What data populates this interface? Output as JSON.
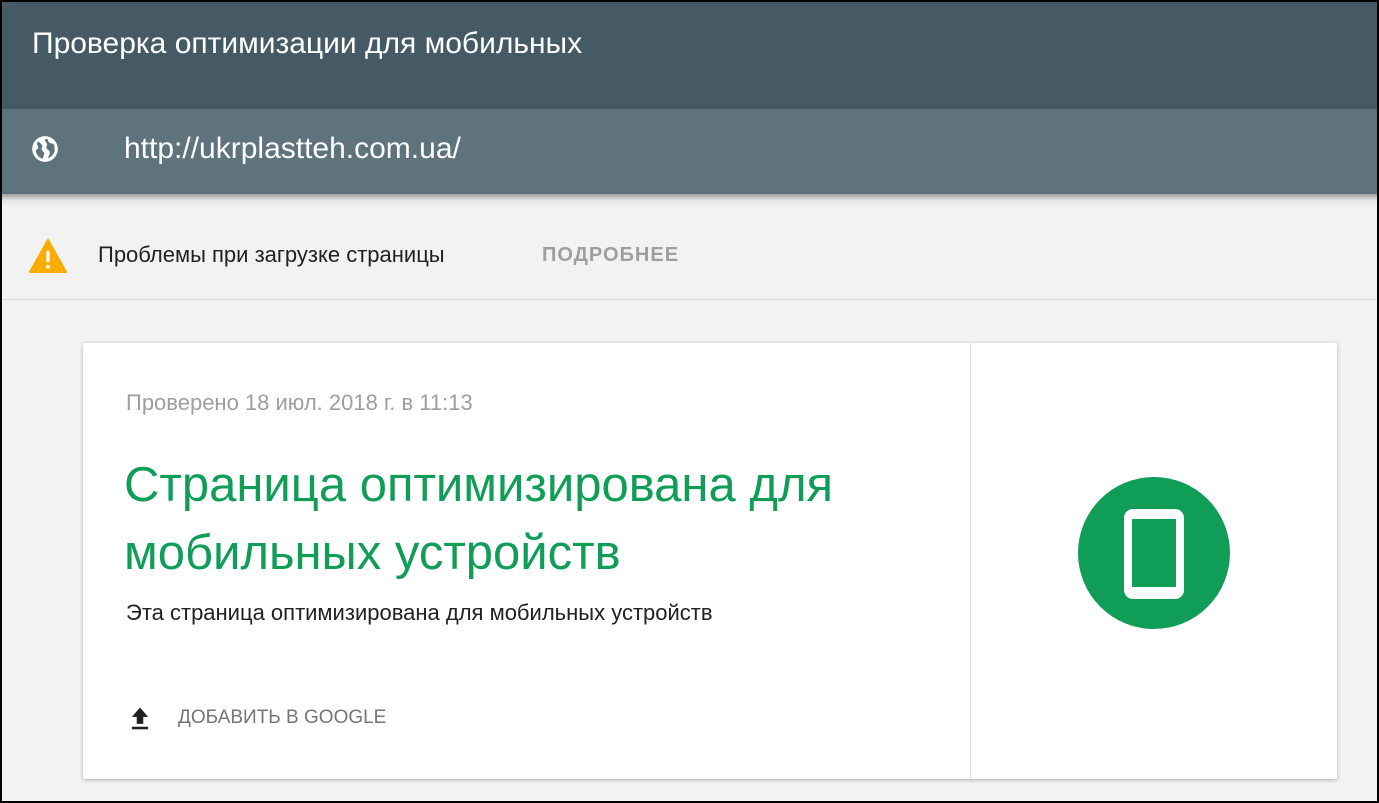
{
  "app": {
    "title": "Проверка оптимизации для мобильных"
  },
  "url_bar": {
    "icon": "globe-icon",
    "value": "http://ukrplastteh.com.ua/"
  },
  "warning": {
    "icon": "warning-icon",
    "text": "Проблемы при загрузке страницы",
    "details_label": "ПОДРОБНЕЕ",
    "color": "#f9ab00"
  },
  "result": {
    "checked_at": "Проверено 18 июл. 2018 г. в 11:13",
    "heading": "Страница оптимизирована для мобильных устройств",
    "description": "Эта страница оптимизирована для мобильных устройств",
    "submit_label": "ДОБАВИТЬ В GOOGLE",
    "submit_icon": "upload-icon",
    "status_icon": "mobile-friendly-icon",
    "accent_color": "#0f9d58"
  },
  "colors": {
    "header": "#455a64",
    "url_bar": "#5f737c",
    "page_background": "#f2f2f2"
  }
}
